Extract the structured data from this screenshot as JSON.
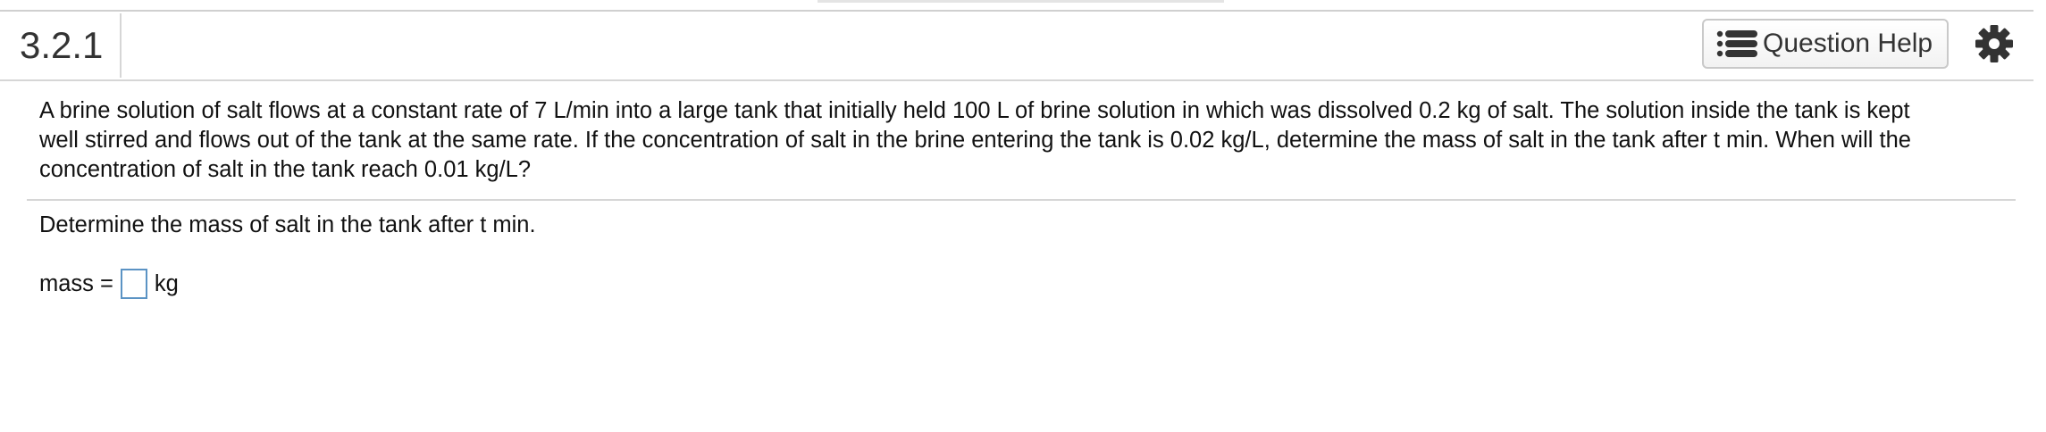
{
  "header": {
    "question_number": "3.2.1",
    "help_button_label": "Question Help",
    "help_icon": "list-icon",
    "settings_icon": "gear-icon"
  },
  "problem": {
    "statement_line_1": "A brine solution of salt flows at a constant rate of 7 L/min into a large tank that initially held 100 L of brine solution in which was dissolved 0.2 kg of salt. The solution inside the tank is kept",
    "statement_line_2": "well stirred and flows out of the tank at the same rate. If the concentration of salt in the brine entering the tank is 0.02 kg/L, determine the mass of salt in the tank after t min. When will the",
    "statement_line_3": "concentration of salt in the tank reach 0.01 kg/L?"
  },
  "part": {
    "prompt": "Determine the mass of salt in the tank after t min.",
    "answer_label": "mass =",
    "answer_value": "",
    "answer_unit": "kg"
  },
  "colors": {
    "accent_input_border": "#5b93c4",
    "divider": "#d6d6d6",
    "icon": "#333333"
  }
}
